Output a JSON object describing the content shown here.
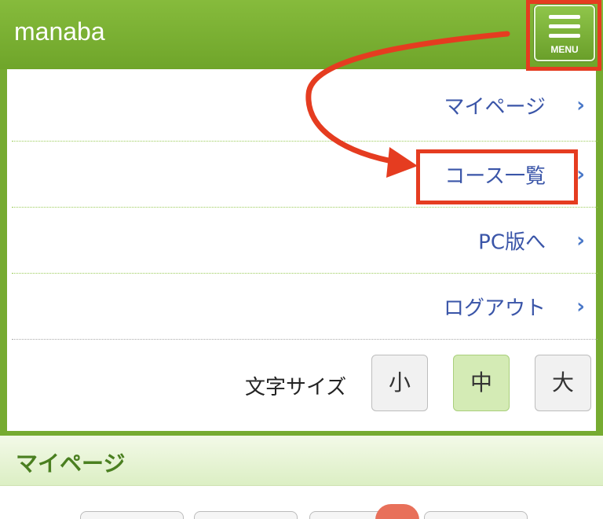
{
  "header": {
    "logo": "manaba",
    "menu_label": "MENU"
  },
  "menu": {
    "items": [
      {
        "label": "マイページ"
      },
      {
        "label": "コース一覧"
      },
      {
        "label": "PC版へ"
      },
      {
        "label": "ログアウト"
      }
    ],
    "chevron": "›"
  },
  "font_size": {
    "label": "文字サイズ",
    "small": "小",
    "medium": "中",
    "large": "大",
    "selected": "中"
  },
  "section": {
    "title": "マイページ"
  },
  "colors": {
    "header_green": "#76ab31",
    "link_blue": "#3a55a8",
    "annotation_red": "#e53c20",
    "selected_green": "#d4ebb5"
  }
}
